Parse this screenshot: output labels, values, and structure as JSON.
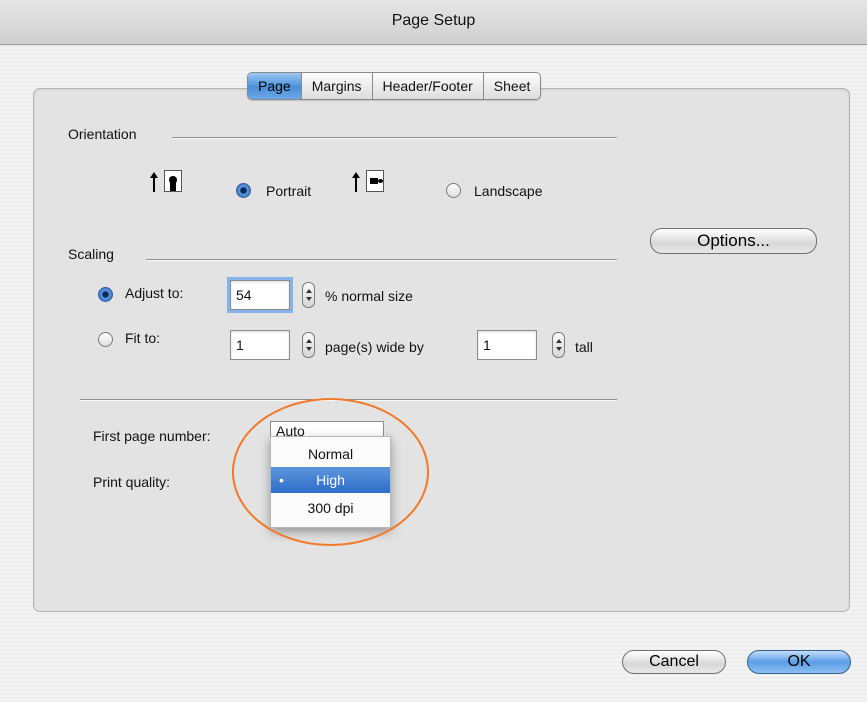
{
  "window": {
    "title": "Page Setup"
  },
  "tabs": [
    {
      "label": "Page",
      "active": true
    },
    {
      "label": "Margins",
      "active": false
    },
    {
      "label": "Header/Footer",
      "active": false
    },
    {
      "label": "Sheet",
      "active": false
    }
  ],
  "orientation": {
    "section_label": "Orientation",
    "portrait_label": "Portrait",
    "landscape_label": "Landscape",
    "selected": "portrait"
  },
  "options_button": "Options...",
  "scaling": {
    "section_label": "Scaling",
    "adjust_label": "Adjust to:",
    "adjust_value": "54",
    "adjust_suffix": "% normal size",
    "fit_label": "Fit to:",
    "fit_wide_value": "1",
    "fit_wide_suffix": "page(s) wide by",
    "fit_tall_value": "1",
    "fit_tall_suffix": "tall",
    "selected": "adjust"
  },
  "first_page": {
    "label": "First page number:",
    "value": "Auto"
  },
  "print_quality": {
    "label": "Print quality:",
    "options": [
      "Normal",
      "High",
      "300 dpi"
    ],
    "selected": "High",
    "selected_marker": "•"
  },
  "buttons": {
    "cancel": "Cancel",
    "ok": "OK"
  },
  "colors": {
    "accent": "#3a7bd5",
    "highlight_circle": "#f07a2a"
  }
}
